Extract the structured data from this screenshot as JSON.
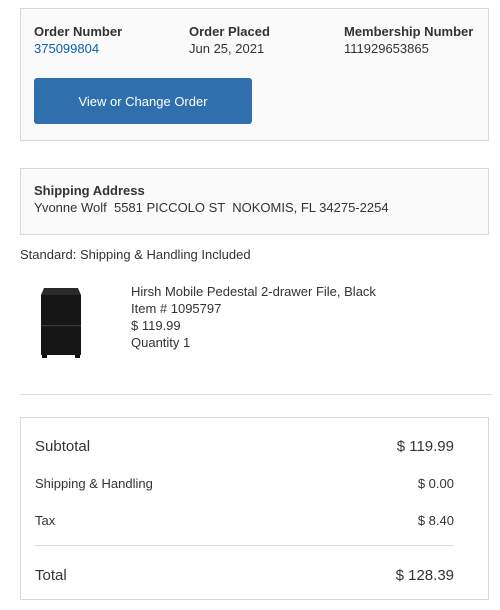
{
  "order": {
    "order_number_label": "Order Number",
    "order_number": "375099804",
    "order_placed_label": "Order Placed",
    "order_placed": "Jun 25, 2021",
    "membership_label": "Membership Number",
    "membership_number": "111929653865",
    "view_change_button": "View or Change Order"
  },
  "shipping": {
    "title": "Shipping Address",
    "address": "Yvonne Wolf  5581 PICCOLO ST  NOKOMIS, FL 34275-2254",
    "method": "Standard: Shipping & Handling Included"
  },
  "product": {
    "name": "Hirsh Mobile Pedestal 2-drawer File, Black",
    "item_number": "Item # 1095797",
    "price": "$ 119.99",
    "quantity": "Quantity 1",
    "image_icon": "file-cabinet-image"
  },
  "summary": {
    "subtotal_label": "Subtotal",
    "subtotal": "$ 119.99",
    "shipping_label": "Shipping & Handling",
    "shipping": "$ 0.00",
    "tax_label": "Tax",
    "tax": "$ 8.40",
    "total_label": "Total",
    "total": "$ 128.39"
  },
  "colors": {
    "link": "#0a5fb4",
    "button": "#2f6fae",
    "card_border": "#d8d8d8",
    "card_bg": "#fafafa"
  }
}
